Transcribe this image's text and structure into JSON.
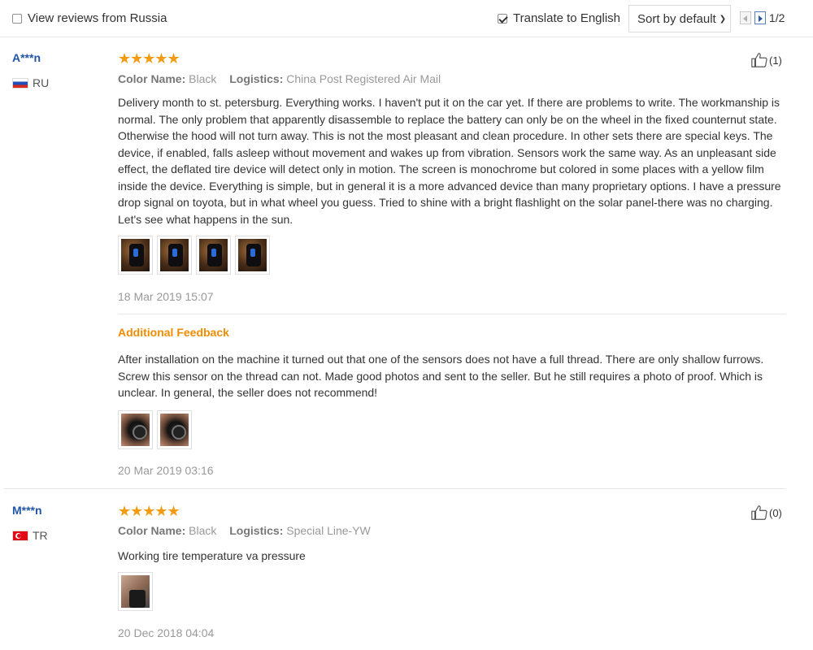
{
  "toolbar": {
    "view_russia_label": "View reviews from Russia",
    "view_russia_checked": false,
    "translate_label": "Translate to English",
    "translate_checked": true,
    "sort_label": "Sort by default",
    "page_indicator": "1/2"
  },
  "reviews": [
    {
      "user": "A***n",
      "country_code": "RU",
      "color_label": "Color Name:",
      "color_value": "Black",
      "logistics_label": "Logistics:",
      "logistics_value": "China Post Registered Air Mail",
      "text": "Delivery month to st. petersburg. Everything works. I haven't put it on the car yet. If there are problems to write. The workmanship is normal. The only problem that apparently disassemble to replace the battery can only be on the wheel in the fixed counternut state. Otherwise the hood will not turn away. This is not the most pleasant and clean procedure. In other sets there are special keys. The device, if enabled, falls asleep without movement and wakes up from vibration. Sensors work the same way. As an unpleasant side effect, the deflated tire device will detect only in motion. The screen is monochrome but colored in some places with a yellow film inside the device. Everything is simple, but in general it is a more advanced device than many proprietary options. I have a pressure drop signal on toyota, but in what wheel you guess. Tried to shine with a bright flashlight on the solar panel-there was no charging. Let's see what happens in the sun.",
      "date": "18 Mar 2019 15:07",
      "likes": "(1)",
      "additional_label": "Additional Feedback",
      "additional_text": "After installation on the machine it turned out that one of the sensors does not have a full thread. There are only shallow furrows. Screw this sensor on the thread can not. Made good photos and sent to the seller. But he still requires a photo of proof. Which is unclear. In general, the seller does not recommend!",
      "additional_date": "20 Mar 2019 03:16"
    },
    {
      "user": "M***n",
      "country_code": "TR",
      "color_label": "Color Name:",
      "color_value": "Black",
      "logistics_label": "Logistics:",
      "logistics_value": "Special Line-YW",
      "text": "Working tire temperature va pressure",
      "date": "20 Dec 2018 04:04",
      "likes": "(0)"
    }
  ],
  "colors": {
    "star": "#f39c12",
    "username": "#2155a7",
    "additional_feedback": "#f08c00",
    "muted": "#999999"
  }
}
